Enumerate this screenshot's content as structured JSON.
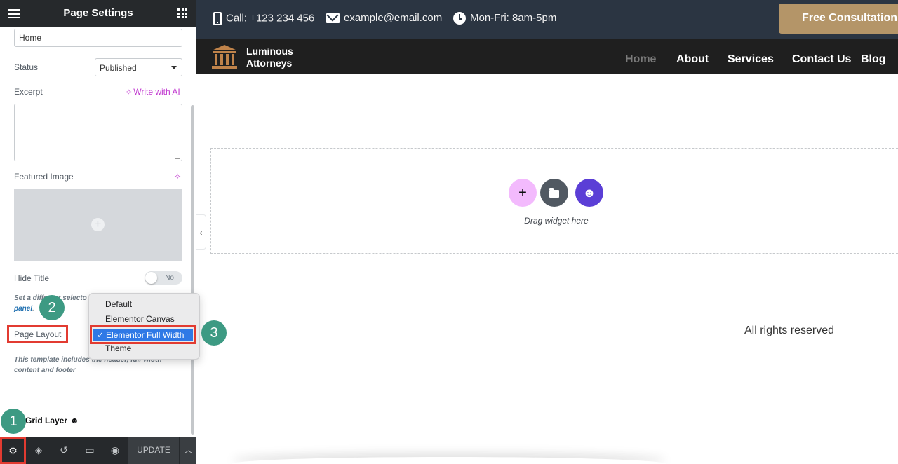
{
  "panel": {
    "title": "Page Settings",
    "title_value": "Home",
    "status_label": "Status",
    "status_value": "Published",
    "excerpt_label": "Excerpt",
    "write_ai_label": "Write with AI",
    "featured_image_label": "Featured Image",
    "hide_title_label": "Hide Title",
    "hide_title_toggle": "No",
    "hide_title_desc_part1": "Set a different selecto",
    "hide_title_desc_link": "panel",
    "hide_title_desc_end": ".",
    "page_layout_label": "Page Layout",
    "layout_desc": "This template includes the header, full-width content and footer",
    "grid_layer_label": "Grid Layer",
    "update_label": "UPDATE"
  },
  "dropdown": {
    "options": [
      "Default",
      "Elementor Canvas",
      "Elementor Full Width",
      "Theme"
    ],
    "selected": "Elementor Full Width"
  },
  "badges": [
    "1",
    "2",
    "3"
  ],
  "preview": {
    "phone": "Call: +123 234 456",
    "email": "example@email.com",
    "hours": "Mon-Fri: 8am-5pm",
    "cta": "Free Consultation",
    "brand_line1": "Luminous",
    "brand_line2": "Attorneys",
    "nav": [
      "Home",
      "About",
      "Services",
      "Contact Us",
      "Blog"
    ],
    "drop_hint": "Drag widget here",
    "footer_text": "All rights reserved"
  },
  "colors": {
    "panel_dark": "#26292c",
    "topbar": "#2b3542",
    "cta": "#b49568",
    "highlight_border": "#e23b31",
    "badge": "#3d9a83",
    "ai_accent": "#c036cf"
  }
}
